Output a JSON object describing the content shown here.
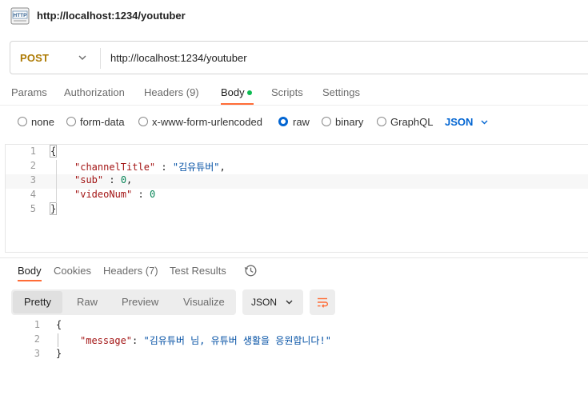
{
  "request": {
    "title": "http://localhost:1234/youtuber",
    "method": "POST",
    "url": "http://localhost:1234/youtuber",
    "icon": "http-icon"
  },
  "request_tabs": [
    {
      "label": "Params"
    },
    {
      "label": "Authorization"
    },
    {
      "label": "Headers (9)"
    },
    {
      "label": "Body"
    },
    {
      "label": "Scripts"
    },
    {
      "label": "Settings"
    }
  ],
  "body_types": [
    {
      "label": "none",
      "checked": false
    },
    {
      "label": "form-data",
      "checked": false
    },
    {
      "label": "x-www-form-urlencoded",
      "checked": false
    },
    {
      "label": "raw",
      "checked": true
    },
    {
      "label": "binary",
      "checked": false
    },
    {
      "label": "GraphQL",
      "checked": false
    }
  ],
  "body_format": "JSON",
  "request_body": {
    "line_numbers": [
      "1",
      "2",
      "3",
      "4",
      "5"
    ],
    "open_brace": "{",
    "close_brace": "}",
    "key1": "\"channelTitle\"",
    "sep1": " : ",
    "val1": "\"김유튜버\"",
    "tail1": ",",
    "key2": "\"sub\"",
    "sep2": " : ",
    "val2": "0",
    "tail2": ",",
    "key3": "\"videoNum\"",
    "sep3": " : ",
    "val3": "0"
  },
  "response_tabs": [
    {
      "label": "Body"
    },
    {
      "label": "Cookies"
    },
    {
      "label": "Headers (7)"
    },
    {
      "label": "Test Results"
    }
  ],
  "view_modes": [
    {
      "label": "Pretty"
    },
    {
      "label": "Raw"
    },
    {
      "label": "Preview"
    },
    {
      "label": "Visualize"
    }
  ],
  "response_format": "JSON",
  "response_body": {
    "line_numbers": [
      "1",
      "2",
      "3"
    ],
    "open_brace": "{",
    "close_brace": "}",
    "key": "\"message\"",
    "sep": ": ",
    "value": "\"김유튜버 님, 유튜버 생활을 응원합니다!\""
  },
  "colors": {
    "method": "#ad7a03",
    "accent": "#ff6c37",
    "link": "#0265d2",
    "body_dot": "#0cbb52"
  }
}
